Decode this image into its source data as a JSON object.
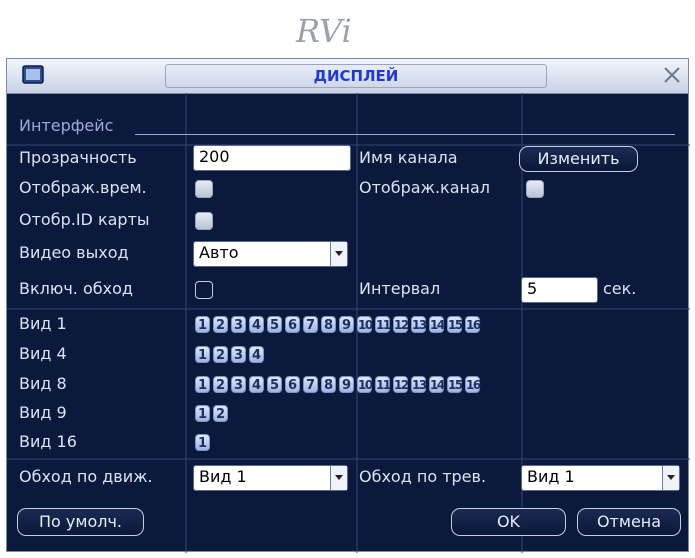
{
  "logo": {
    "text": "RVi"
  },
  "window": {
    "title": "ДИСПЛЕЙ"
  },
  "section": {
    "title": "Интерфейс"
  },
  "fields": {
    "transparency": {
      "label": "Прозрачность",
      "value": "200"
    },
    "channel_name": {
      "label": "Имя канала",
      "button": "Изменить"
    },
    "show_time": {
      "label": "Отображ.врем.",
      "checked": true
    },
    "show_channel": {
      "label": "Отображ.канал",
      "checked": true
    },
    "show_card_id": {
      "label": "Отобр.ID карты",
      "checked": true
    },
    "video_out": {
      "label": "Видео выход",
      "value": "Авто"
    },
    "tour": {
      "label": "Включ. обход",
      "checked": false
    },
    "interval": {
      "label": "Интервал",
      "value": "5",
      "unit": "сек."
    }
  },
  "views": [
    {
      "label": "Вид 1",
      "cells": [
        "1",
        "2",
        "3",
        "4",
        "5",
        "6",
        "7",
        "8",
        "9",
        "10",
        "11",
        "12",
        "13",
        "14",
        "15",
        "16"
      ]
    },
    {
      "label": "Вид 4",
      "cells": [
        "1",
        "2",
        "3",
        "4"
      ]
    },
    {
      "label": "Вид 8",
      "cells": [
        "1",
        "2",
        "3",
        "4",
        "5",
        "6",
        "7",
        "8",
        "9",
        "10",
        "11",
        "12",
        "13",
        "14",
        "15",
        "16"
      ]
    },
    {
      "label": "Вид 9",
      "cells": [
        "1",
        "2"
      ]
    },
    {
      "label": "Вид 16",
      "cells": [
        "1"
      ]
    }
  ],
  "motion_tour": {
    "label": "Обход по движ.",
    "value": "Вид 1"
  },
  "alarm_tour": {
    "label": "Обход по трев.",
    "value": "Вид 1"
  },
  "buttons": {
    "default": "По умолч.",
    "ok": "OK",
    "cancel": "Отмена"
  },
  "colors": {
    "background": "#0b1a3c",
    "title_text": "#1e3ad0",
    "label_text": "#dbe3f3"
  }
}
